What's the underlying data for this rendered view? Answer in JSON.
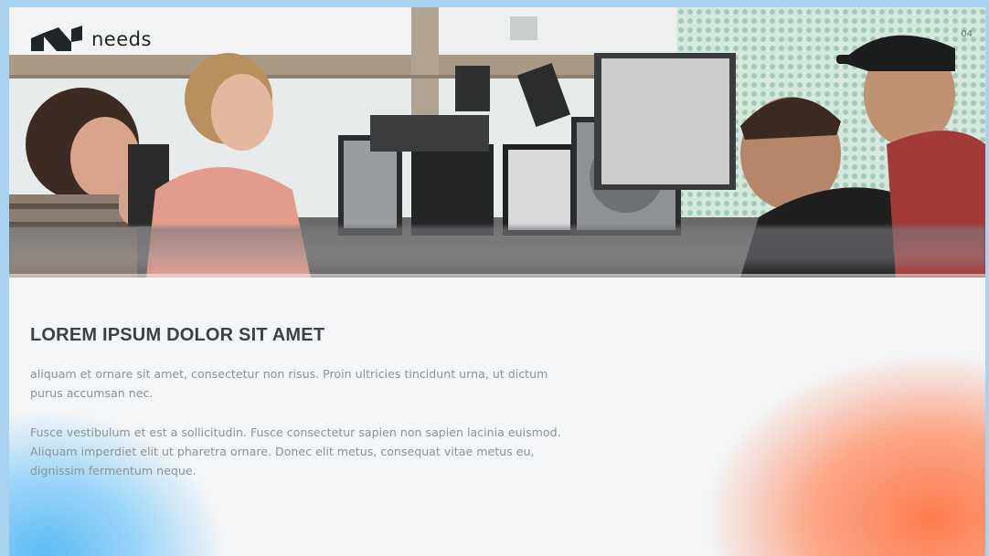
{
  "brand": {
    "name": "needs",
    "logo_icon": "needs-logo-mark"
  },
  "page_number": "04",
  "hero": {
    "image": "office-team-at-computers-photo"
  },
  "content": {
    "heading": "LOREM IPSUM DOLOR SIT AMET",
    "paragraph_1": "aliquam et ornare sit amet, consectetur non risus. Proin ultricies tincidunt urna, ut dictum purus accumsan nec.",
    "paragraph_2": "Fusce vestibulum et est a sollicitudin. Fusce consectetur sapien non sapien lacinia euismod. Aliquam imperdiet elit ut pharetra ornare. Donec elit metus, consequat vitae metus eu, dignissim fermentum neque."
  },
  "colors": {
    "accent_orange": "#ff7646",
    "accent_blue": "#54b8f6",
    "background": "#f3f5f7",
    "heading": "#3c4145",
    "body_text": "#8c9296"
  }
}
